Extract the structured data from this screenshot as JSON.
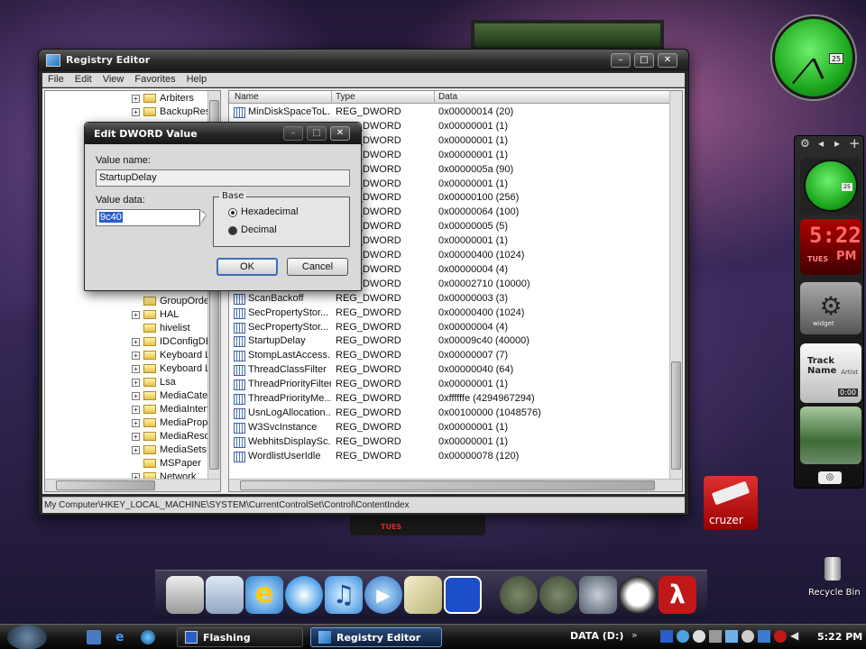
{
  "window": {
    "title": "Registry Editor",
    "menu": [
      "File",
      "Edit",
      "View",
      "Favorites",
      "Help"
    ],
    "status_path": "My Computer\\HKEY_LOCAL_MACHINE\\SYSTEM\\CurrentControlSet\\Control\\ContentIndex"
  },
  "tree": {
    "top_items": [
      "Arbiters",
      "BackupRest"
    ],
    "bottom_items": [
      {
        "label": "GroupOrder",
        "expand": false
      },
      {
        "label": "HAL",
        "expand": true
      },
      {
        "label": "hivelist",
        "expand": false
      },
      {
        "label": "IDConfigDB",
        "expand": true
      },
      {
        "label": "Keyboard La",
        "expand": true
      },
      {
        "label": "Keyboard La",
        "expand": true
      },
      {
        "label": "Lsa",
        "expand": true
      },
      {
        "label": "MediaCateg",
        "expand": true
      },
      {
        "label": "MediaInterf",
        "expand": true
      },
      {
        "label": "MediaProper",
        "expand": true
      },
      {
        "label": "MediaResou",
        "expand": true
      },
      {
        "label": "MediaSets",
        "expand": true
      },
      {
        "label": "MSPaper",
        "expand": false
      },
      {
        "label": "Network",
        "expand": true
      }
    ]
  },
  "list": {
    "headers": {
      "name": "Name",
      "type": "Type",
      "data": "Data"
    },
    "rows": [
      {
        "name": "MinDiskSpaceToL...",
        "type": "REG_DWORD",
        "data": "0x00000014 (20)"
      },
      {
        "name": "",
        "type": "REG_DWORD",
        "data": "0x00000001 (1)"
      },
      {
        "name": "",
        "type": "REG_DWORD",
        "data": "0x00000001 (1)"
      },
      {
        "name": "",
        "type": "REG_DWORD",
        "data": "0x00000001 (1)"
      },
      {
        "name": "",
        "type": "REG_DWORD",
        "data": "0x0000005a (90)"
      },
      {
        "name": "",
        "type": "REG_DWORD",
        "data": "0x00000001 (1)"
      },
      {
        "name": "",
        "type": "REG_DWORD",
        "data": "0x00000100 (256)"
      },
      {
        "name": "",
        "type": "REG_DWORD",
        "data": "0x00000064 (100)"
      },
      {
        "name": "",
        "type": "REG_DWORD",
        "data": "0x00000005 (5)"
      },
      {
        "name": "",
        "type": "REG_DWORD",
        "data": "0x00000001 (1)"
      },
      {
        "name": "",
        "type": "REG_DWORD",
        "data": "0x00000400 (1024)"
      },
      {
        "name": "",
        "type": "REG_DWORD",
        "data": "0x00000004 (4)"
      },
      {
        "name": "",
        "type": "REG_DWORD",
        "data": "0x00002710 (10000)"
      },
      {
        "name": "ScanBackoff",
        "type": "REG_DWORD",
        "data": "0x00000003 (3)"
      },
      {
        "name": "SecPropertyStor...",
        "type": "REG_DWORD",
        "data": "0x00000400 (1024)"
      },
      {
        "name": "SecPropertyStor...",
        "type": "REG_DWORD",
        "data": "0x00000004 (4)"
      },
      {
        "name": "StartupDelay",
        "type": "REG_DWORD",
        "data": "0x00009c40 (40000)"
      },
      {
        "name": "StompLastAccess...",
        "type": "REG_DWORD",
        "data": "0x00000007 (7)"
      },
      {
        "name": "ThreadClassFilter",
        "type": "REG_DWORD",
        "data": "0x00000040 (64)"
      },
      {
        "name": "ThreadPriorityFilter",
        "type": "REG_DWORD",
        "data": "0x00000001 (1)"
      },
      {
        "name": "ThreadPriorityMe...",
        "type": "REG_DWORD",
        "data": "0xffffffe (4294967294)"
      },
      {
        "name": "UsnLogAllocation...",
        "type": "REG_DWORD",
        "data": "0x00100000 (1048576)"
      },
      {
        "name": "W3SvcInstance",
        "type": "REG_DWORD",
        "data": "0x00000001 (1)"
      },
      {
        "name": "WebhitsDisplaySc...",
        "type": "REG_DWORD",
        "data": "0x00000001 (1)"
      },
      {
        "name": "WordlistUserIdle",
        "type": "REG_DWORD",
        "data": "0x00000078 (120)"
      }
    ]
  },
  "dialog": {
    "title": "Edit DWORD Value",
    "value_name_label": "Value name:",
    "value_name": "StartupDelay",
    "value_data_label": "Value data:",
    "value_data": "9c40",
    "base_label": "Base",
    "hex_label": "Hexadecimal",
    "dec_label": "Decimal",
    "ok": "OK",
    "cancel": "Cancel"
  },
  "gadgets": {
    "clock_day": "25",
    "digital_time": "5:22",
    "digital_day": "TUES",
    "digital_ampm": "PM",
    "widget_label": "widget",
    "track_name": "Track Name",
    "artist": "Artist",
    "track_time": "0:00"
  },
  "desktop": {
    "cruzer_label": "cruzer",
    "recycle_bin": "Recycle Bin",
    "tues_small": "TUES"
  },
  "taskbar": {
    "tasks": [
      "Flashing",
      "Registry Editor"
    ],
    "drive_label": "DATA (D:)",
    "clock": "5:22 PM"
  }
}
